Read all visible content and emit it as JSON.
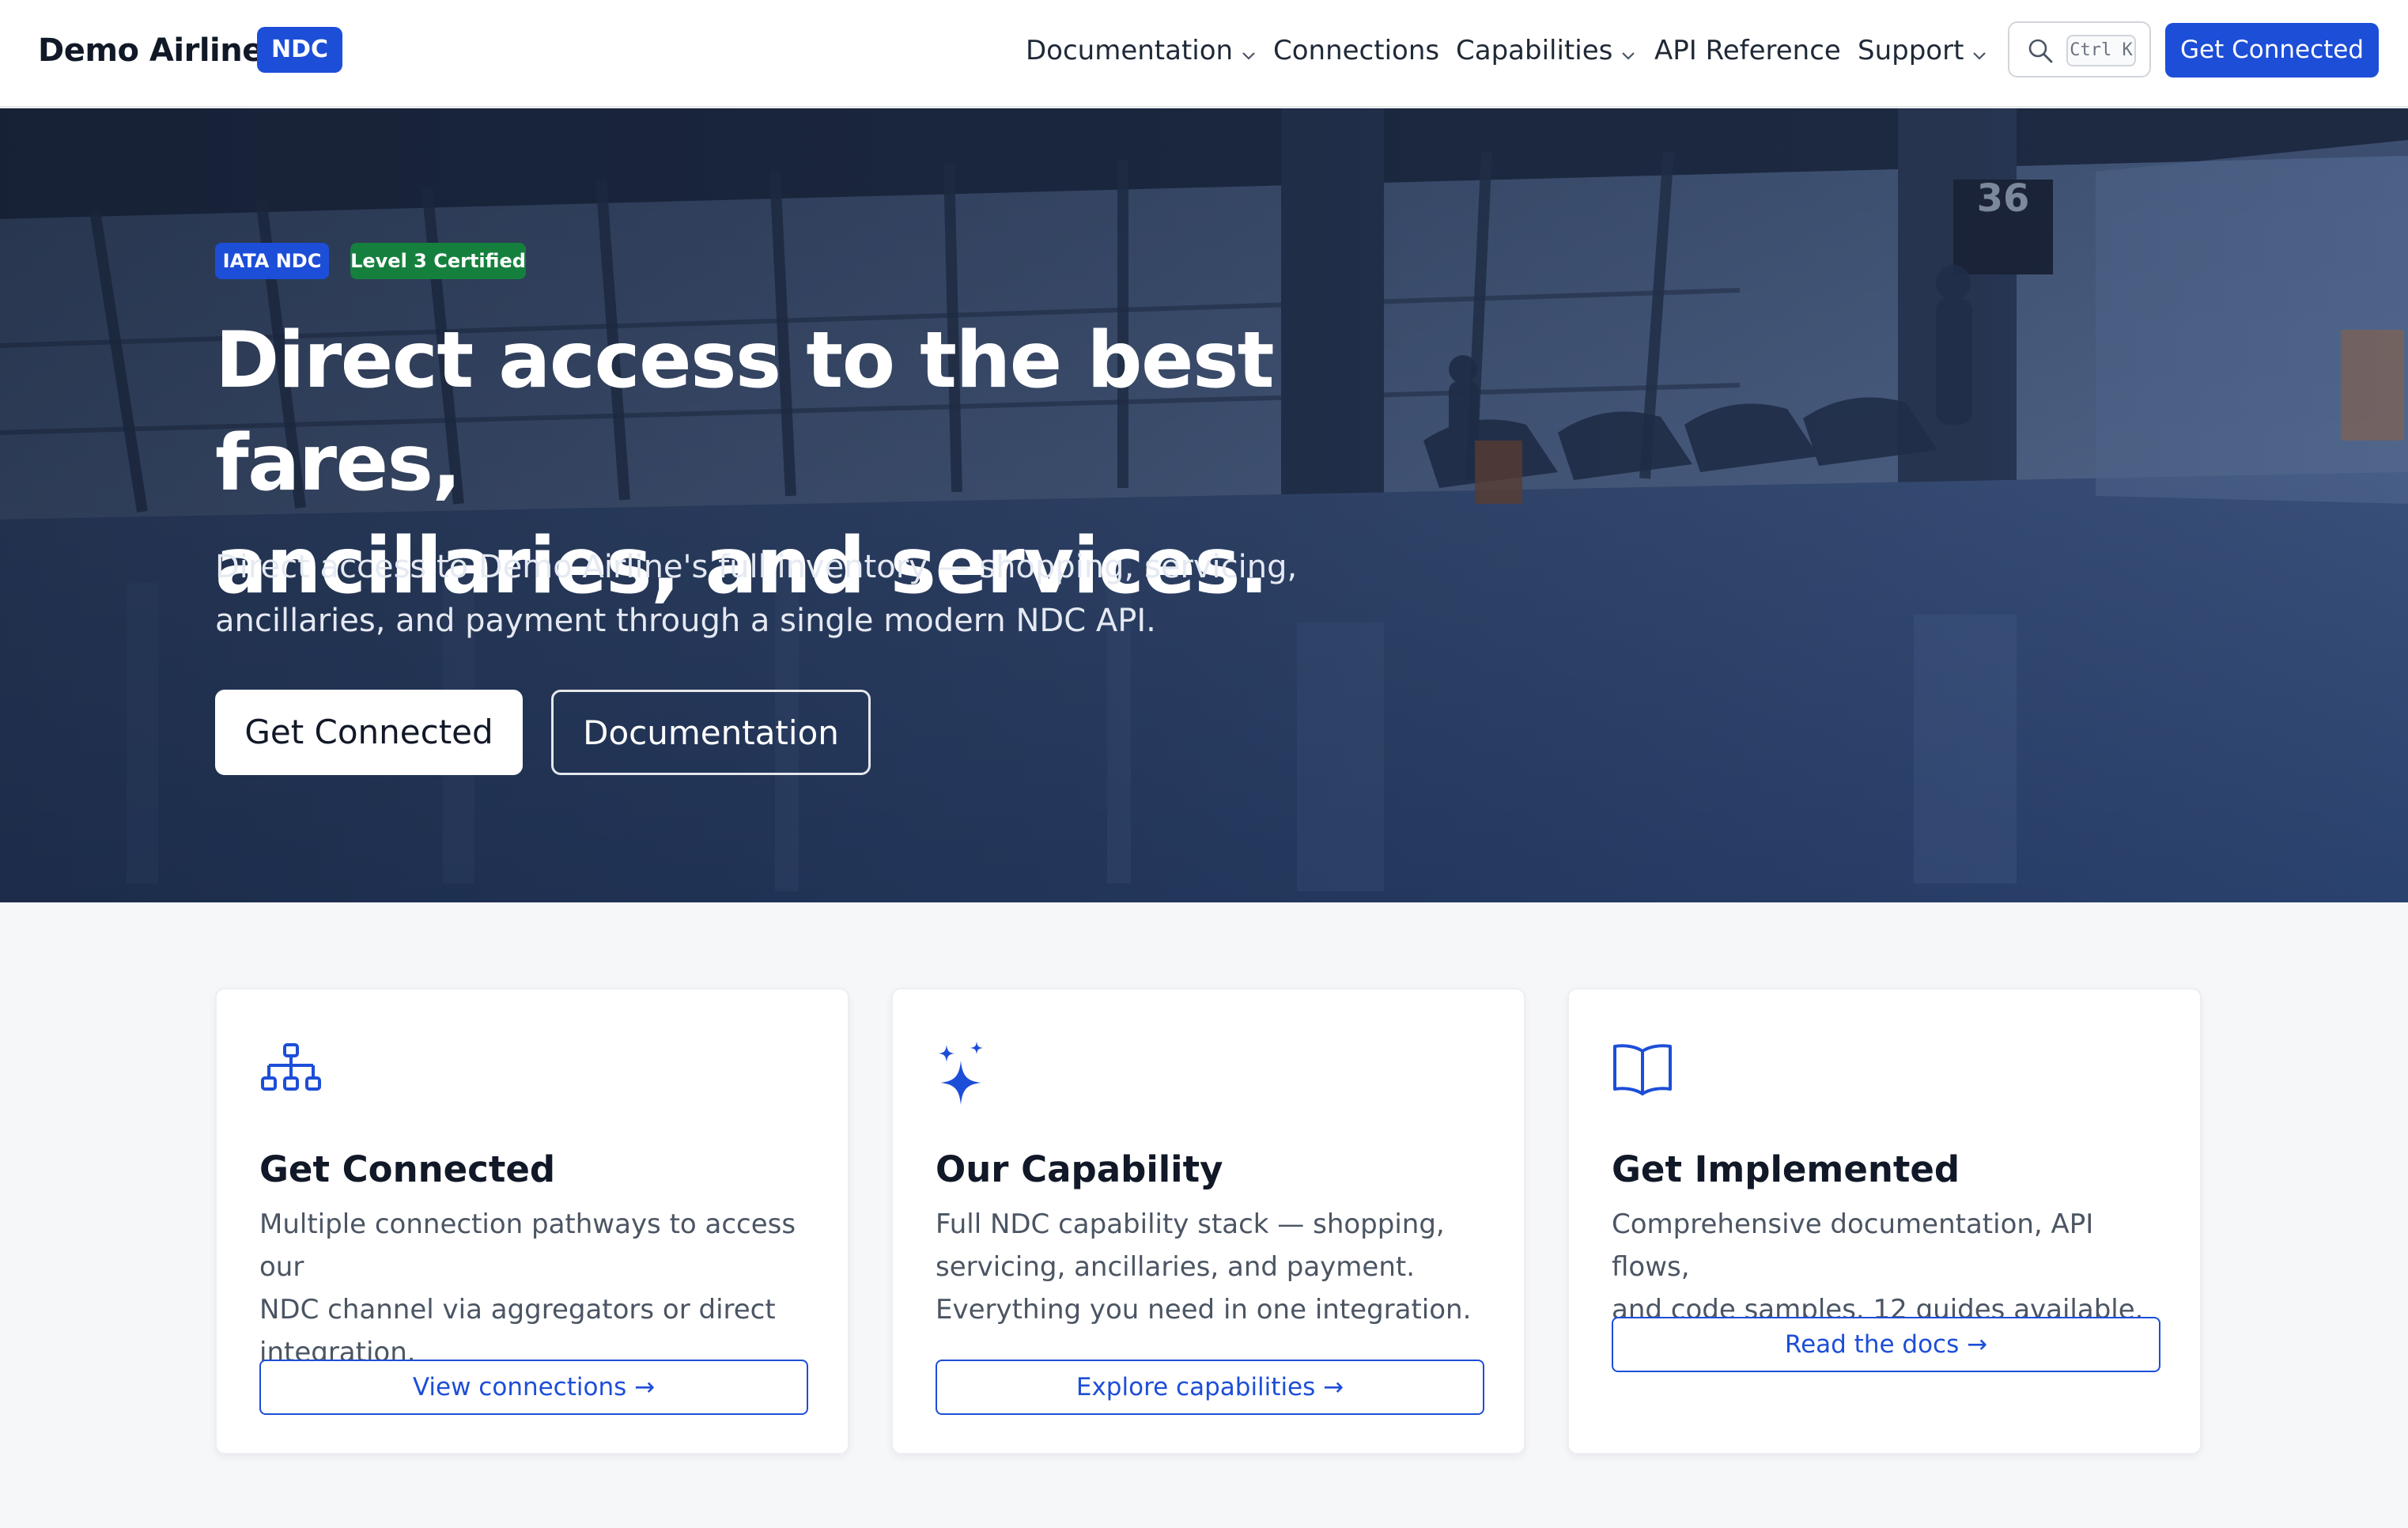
{
  "header": {
    "brand_name": "Demo Airline",
    "brand_badge": "NDC",
    "nav": {
      "documentation": "Documentation",
      "connections": "Connections",
      "capabilities": "Capabilities",
      "api_reference": "API Reference",
      "support": "Support"
    },
    "search_shortcut": "Ctrl K",
    "cta_label": "Get Connected"
  },
  "hero": {
    "badges": [
      "IATA NDC",
      "Level 3 Certified"
    ],
    "title_line1": "Direct access to the best fares,",
    "title_line2": "ancillaries, and services.",
    "subtitle_line1": "Direct access to Demo Airline's full inventory — shopping, servicing,",
    "subtitle_line2": "ancillaries, and payment through a single modern NDC API.",
    "primary_button": "Get Connected",
    "secondary_button": "Documentation",
    "gate_sign": "36"
  },
  "cards": [
    {
      "icon": "network-icon",
      "title": "Get Connected",
      "desc_lines": [
        "Multiple connection pathways to access our",
        "NDC channel via aggregators or direct",
        "integration."
      ],
      "link": "View connections →"
    },
    {
      "icon": "sparkles-icon",
      "title": "Our Capability",
      "desc_lines": [
        "Full NDC capability stack — shopping,",
        "servicing, ancillaries, and payment.",
        "Everything you need in one integration."
      ],
      "link": "Explore capabilities →"
    },
    {
      "icon": "book-open-icon",
      "title": "Get Implemented",
      "desc_lines": [
        "Comprehensive documentation, API flows,",
        "and code samples. 12 guides available."
      ],
      "link": "Read the docs →"
    }
  ],
  "colors": {
    "brand_blue": "#1d4ed8",
    "certified_green": "#15803d",
    "page_bg": "#f6f7f9",
    "hero_bg": "#31446a"
  }
}
